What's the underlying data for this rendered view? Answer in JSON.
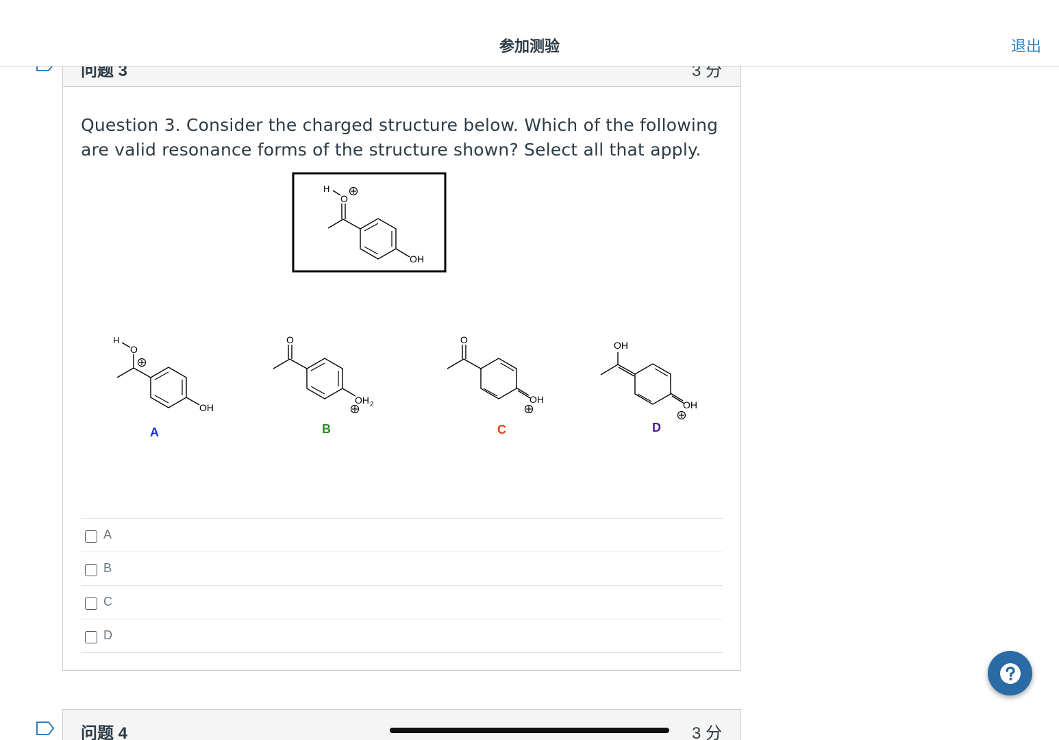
{
  "header": {
    "title": "参加测验",
    "exit_label": "退出"
  },
  "question3": {
    "name": "问题 3",
    "points": "3 分",
    "text": "Question 3. Consider the charged structure below.  Which of the following are valid resonance forms of the structure shown?  Select all that apply.",
    "structure_labels": {
      "main": {
        "h": "H",
        "o": "O",
        "oh": "OH"
      },
      "a": {
        "label": "A",
        "h": "H",
        "o": "O",
        "oh": "OH",
        "color": "#1a2fd6"
      },
      "b": {
        "label": "B",
        "o": "O",
        "oh2": "OH",
        "sub": "2",
        "color": "#2e8b25"
      },
      "c": {
        "label": "C",
        "o": "O",
        "oh": "OH",
        "color": "#e8401c"
      },
      "d": {
        "label": "D",
        "oh_top": "OH",
        "oh": "OH",
        "color": "#4b1f96"
      }
    },
    "options": [
      {
        "label": "A",
        "checked": false
      },
      {
        "label": "B",
        "checked": false
      },
      {
        "label": "C",
        "checked": false
      },
      {
        "label": "D",
        "checked": false
      }
    ]
  },
  "question4": {
    "name": "问题 4",
    "points": "3 分"
  },
  "colors": {
    "link": "#2f7fbf",
    "help_button": "#2a6aa5"
  },
  "icons": [
    "bookmark-icon",
    "help-icon",
    "checkbox-icon"
  ]
}
